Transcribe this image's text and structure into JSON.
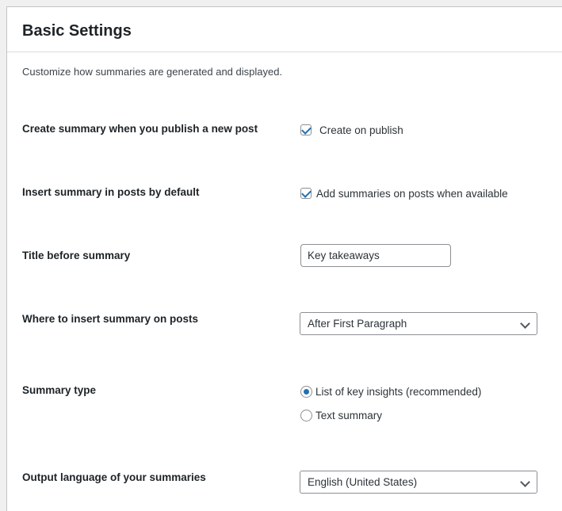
{
  "panel": {
    "title": "Basic Settings",
    "description": "Customize how summaries are generated and displayed."
  },
  "rows": {
    "publish": {
      "label": "Create summary when you publish a new post",
      "checkbox_label": "Create on publish",
      "checked": true
    },
    "insert": {
      "label": "Insert summary in posts by default",
      "checkbox_label": "Add summaries on posts when available",
      "checked": true
    },
    "title": {
      "label": "Title before summary",
      "value": "Key takeaways"
    },
    "position": {
      "label": "Where to insert summary on posts",
      "selected": "After First Paragraph"
    },
    "type": {
      "label": "Summary type",
      "options": [
        {
          "label": "List of key insights (recommended)",
          "checked": true
        },
        {
          "label": "Text summary",
          "checked": false
        }
      ]
    },
    "language": {
      "label": "Output language of your summaries",
      "selected": "English (United States)"
    }
  },
  "colors": {
    "accent": "#2271b1",
    "border": "#8c8f94",
    "background": "#f0f0f1"
  }
}
